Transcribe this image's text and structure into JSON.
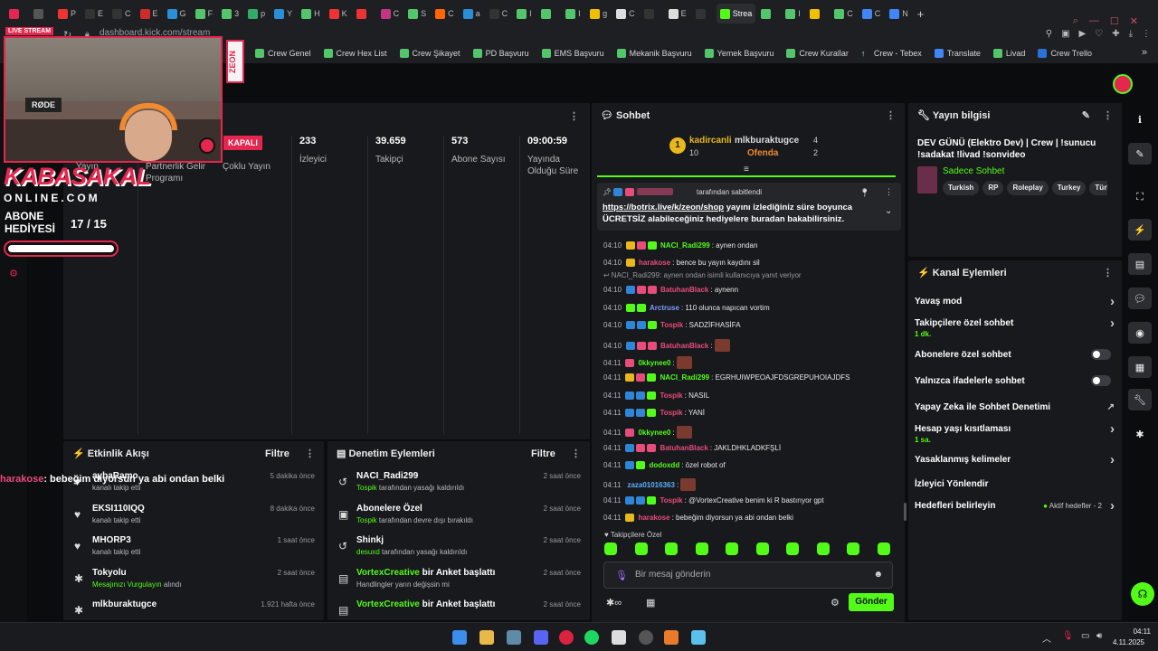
{
  "browser": {
    "tabs": [
      "",
      "",
      "P",
      "E",
      "C",
      "E",
      "G",
      "F",
      "3",
      "p",
      "Y",
      "H",
      "K",
      "",
      "C",
      "S",
      "C",
      "a",
      "C",
      "I",
      "",
      "I",
      "g",
      "C",
      "",
      "E",
      "",
      "Strea",
      "",
      "I",
      "",
      "C",
      "C",
      "N"
    ],
    "active_tab_label": "Strea",
    "address": "dashboard.kick.com/stream",
    "bookmarks": [
      "Crew Genel",
      "Crew Hex List",
      "Crew Şikayet",
      "PD Başvuru",
      "EMS Başvuru",
      "Mekanik Başvuru",
      "Yemek Başvuru",
      "Crew Kurallar",
      "Crew - Tebex",
      "Translate",
      "Livad",
      "Crew Trello"
    ]
  },
  "overlay": {
    "live_label": "LIVE STREAM",
    "mic_brand": "RØDE",
    "zeon": "ZEON",
    "brand_line1": "KABASAKAL",
    "brand_line2": "ONLINE.COM",
    "abone_line1": "ABONE",
    "abone_line2": "HEDİYESİ",
    "abone_current": "17",
    "abone_sep": "/",
    "abone_target": "15",
    "abone_progress": 1.0,
    "chat_overlay_user": "harakose",
    "chat_overlay_text": ": bebeğim diyorsun ya abi ondan belki"
  },
  "stats": {
    "kapali": "KAPALI",
    "col1_label": "Yayın",
    "col2_label": "Partnerlik Gelir Programı",
    "col3_label": "Çoklu Yayın",
    "viewers_value": "233",
    "viewers_label": "İzleyici",
    "followers_value": "39.659",
    "followers_label": "Takipçi",
    "subs_value": "573",
    "subs_label": "Abone Sayısı",
    "uptime_value": "09:00:59",
    "uptime_label": "Yayında Olduğu Süre"
  },
  "events": {
    "title": "Etkinlik Akışı",
    "filter": "Filtre",
    "items": [
      {
        "name": "aybaRamo",
        "action": "kanalı takip etti",
        "time": "5 dakika önce"
      },
      {
        "name": "EKSI110IQQ",
        "action": "kanalı takip etti",
        "time": "8 dakika önce"
      },
      {
        "name": "MHORP3",
        "action": "kanalı takip etti",
        "time": "1 saat önce"
      },
      {
        "name": "Tokyolu",
        "action_hl": "Mesajınızı Vurgulayın",
        "action": "alındı",
        "time": "2 saat önce"
      },
      {
        "name": "mlkburaktugce",
        "action": "",
        "time": "1.921 hafta önce"
      }
    ]
  },
  "mod": {
    "title": "Denetim Eylemleri",
    "filter": "Filtre",
    "items": [
      {
        "name": "NACI_Radi299",
        "by": "Tospik",
        "action": "tarafından yasağı kaldırıldı",
        "time": "2 saat önce"
      },
      {
        "name": "Abonelere Özel",
        "by": "Tospik",
        "action": "tarafından devre dışı bırakıldı",
        "time": "2 saat önce"
      },
      {
        "name": "Shinkj",
        "by": "desuxd",
        "action": "tarafından yasağı kaldırıldı",
        "time": "2 saat önce"
      },
      {
        "name": "VortexCreative",
        "name_suffix": "bir Anket başlattı",
        "by": "",
        "action": "Handlingler yarın değişsin mi",
        "time": "2 saat önce"
      },
      {
        "name": "VortexCreative",
        "name_suffix": "bir Anket başlattı",
        "by": "",
        "action": "",
        "time": "2 saat önce"
      }
    ]
  },
  "chat": {
    "title": "Sohbet",
    "top1_name": "kadircanli",
    "top1_count": "10",
    "top1_rank": "1",
    "top2_name": "mlkburaktugce",
    "top2_count": "4",
    "top3_name": "Ofenda",
    "top3_count": "2",
    "pinned_by": "tarafından sabitlendi",
    "pinned_link": "https://botrix.live/k/zeon/shop",
    "pinned_text": " yayını izlediğiniz süre boyunca ÜCRETSİZ alabileceğiniz hediyelere buradan bakabilirsiniz.",
    "reply_note": "NACI_Radi299: aynen ondan isimli kullanıcıya yanıt veriyor",
    "messages": [
      {
        "time": "04:10",
        "user": "NACI_Radi299",
        "color": "#53fc18",
        "text": ": aynen ondan",
        "badges": [
          "gold",
          "pink",
          "green"
        ]
      },
      {
        "time": "04:10",
        "user": "harakose",
        "color": "#e74c7a",
        "text": ": bence bu yayın kaydını sil",
        "badges": [
          "gold"
        ]
      },
      {
        "time": "04:10",
        "user": "BatuhanBlack",
        "color": "#e74c7a",
        "text": ": aynenn",
        "badges": [
          "blue",
          "pink",
          "pink"
        ]
      },
      {
        "time": "04:10",
        "user": "Arctruse",
        "color": "#7b9cff",
        "text": ": 110 olunca napıcan vortim",
        "badges": [
          "green",
          "green"
        ]
      },
      {
        "time": "04:10",
        "user": "Tospik",
        "color": "#e74c7a",
        "text": ": SADZİFHASİFA",
        "badges": [
          "blue",
          "blue",
          "green"
        ]
      },
      {
        "time": "04:10",
        "user": "BatuhanBlack",
        "color": "#e74c7a",
        "text": ":",
        "badges": [
          "blue",
          "pink",
          "pink"
        ],
        "emote": true
      },
      {
        "time": "04:11",
        "user": "0kkynee0",
        "color": "#53fc18",
        "text": ":",
        "badges": [
          "pink"
        ],
        "emote": true
      },
      {
        "time": "04:11",
        "user": "NACI_Radi299",
        "color": "#53fc18",
        "text": ": EGRHUIWPEOAJFDSGREPUHOIAJDFS",
        "badges": [
          "gold",
          "pink",
          "green"
        ]
      },
      {
        "time": "04:11",
        "user": "Tospik",
        "color": "#e74c7a",
        "text": ": NASIL",
        "badges": [
          "blue",
          "blue",
          "green"
        ]
      },
      {
        "time": "04:11",
        "user": "Tospik",
        "color": "#e74c7a",
        "text": ": YANİ",
        "badges": [
          "blue",
          "blue",
          "green"
        ]
      },
      {
        "time": "04:11",
        "user": "0kkynee0",
        "color": "#53fc18",
        "text": ":",
        "badges": [
          "pink"
        ],
        "emote": true
      },
      {
        "time": "04:11",
        "user": "BatuhanBlack",
        "color": "#e74c7a",
        "text": ": JAKLDHKLADKFŞLİ",
        "badges": [
          "blue",
          "pink",
          "pink"
        ]
      },
      {
        "time": "04:11",
        "user": "dodoxdd",
        "color": "#53fc18",
        "text": ": özel robot of",
        "badges": [
          "blue",
          "green"
        ]
      },
      {
        "time": "04:11",
        "user": "zaza01016363",
        "color": "#5ab0ff",
        "text": ":",
        "badges": [],
        "emote": true
      },
      {
        "time": "04:11",
        "user": "Tospik",
        "color": "#e74c7a",
        "text": ": @VortexCreative benim ki R bastırıyor gpt",
        "badges": [
          "blue",
          "blue",
          "green"
        ]
      },
      {
        "time": "04:11",
        "user": "harakose",
        "color": "#e74c7a",
        "text": ": bebeğim diyorsun ya abi ondan belki",
        "badges": [
          "gold"
        ]
      }
    ],
    "followers_only": "Takipçilere Özel",
    "input_placeholder": "Bir mesaj gönderin",
    "send": "Gönder"
  },
  "info": {
    "title": "Yayın bilgisi",
    "stream_title": "DEV GÜNÜ (Elektro Dev) | Crew | !sunucu !sadakat !livad !sonvideo",
    "category": "Sadece Sohbet",
    "tags": [
      "Turkish",
      "RP",
      "Roleplay",
      "Turkey",
      "Türk"
    ]
  },
  "kanal": {
    "title": "Kanal Eylemleri",
    "rows": [
      {
        "label": "Yavaş mod",
        "sub": "",
        "type": "arrow"
      },
      {
        "label": "Takipçilere özel sohbet",
        "sub": "1 dk.",
        "type": "arrow"
      },
      {
        "label": "Abonelere özel sohbet",
        "sub": "",
        "type": "toggle"
      },
      {
        "label": "Yalnızca ifadelerle sohbet",
        "sub": "",
        "type": "toggle"
      },
      {
        "label": "Yapay Zeka ile Sohbet Denetimi",
        "sub": "",
        "type": "ext"
      },
      {
        "label": "Hesap yaşı kısıtlaması",
        "sub": "1 sa.",
        "type": "arrow"
      },
      {
        "label": "Yasaklanmış kelimeler",
        "sub": "",
        "type": "arrow"
      },
      {
        "label": "İzleyici Yönlendir",
        "sub": "",
        "type": "none"
      },
      {
        "label": "Hedefleri belirleyin",
        "sub": "",
        "type": "goals"
      }
    ],
    "goals_note": "Aktif hedefler - 2"
  },
  "taskbar": {
    "time": "04:11",
    "date": "4.11.2025"
  },
  "colors": {
    "kick_green": "#53fc18",
    "accent_red": "#e5264e"
  }
}
